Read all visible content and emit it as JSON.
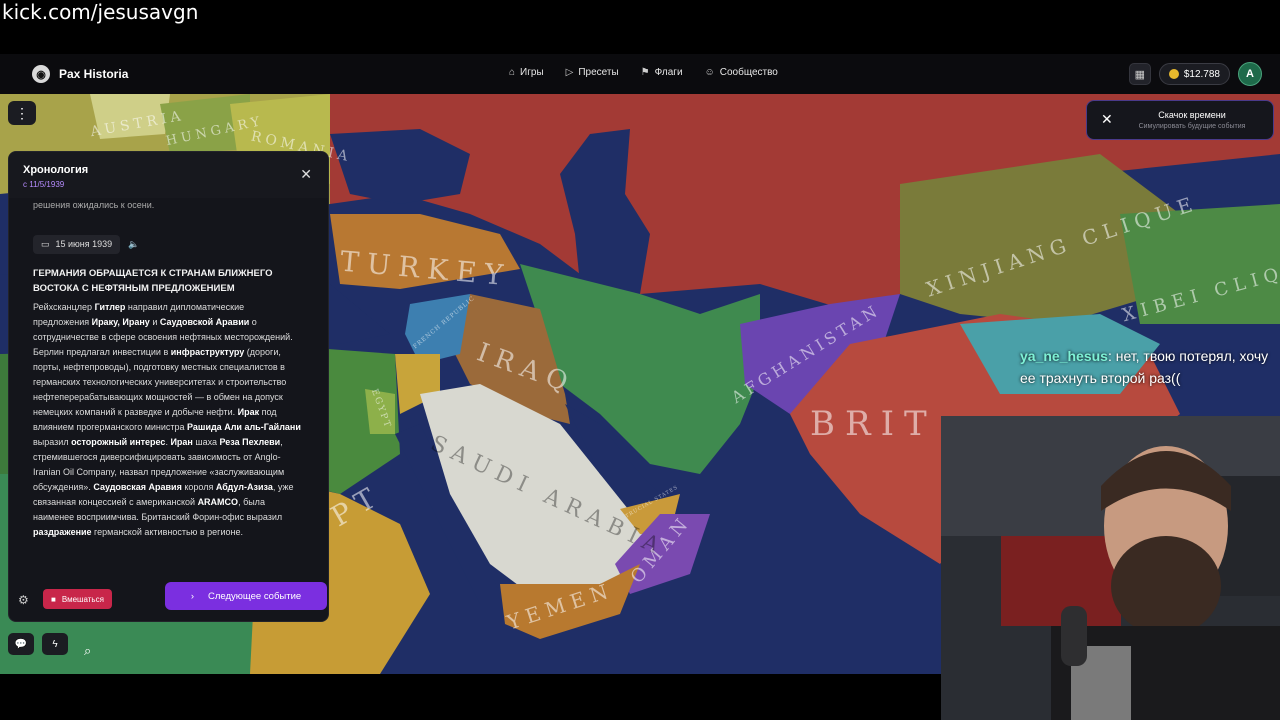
{
  "stream": {
    "url": "kick.com/jesusavgn"
  },
  "app": {
    "name": "Pax Historia",
    "nav": [
      {
        "icon": "gamepad-icon",
        "label": "Игры"
      },
      {
        "icon": "play-icon",
        "label": "Пресеты"
      },
      {
        "icon": "flag-icon",
        "label": "Флаги"
      },
      {
        "icon": "people-icon",
        "label": "Сообщество"
      }
    ],
    "balance": "$12.788",
    "avatar_initial": "A"
  },
  "time_jump": {
    "title": "Скачок времени",
    "subtitle": "Симулировать будущие события"
  },
  "timeline": {
    "title": "Хронология",
    "since": "с 11/5/1939",
    "prev_tail": "решения ожидались к осени.",
    "date": "15 июня 1939",
    "event_title": "ГЕРМАНИЯ ОБРАЩАЕТСЯ К СТРАНАМ БЛИЖНЕГО ВОСТОКА С НЕФТЯНЫМ ПРЕДЛОЖЕНИЕМ",
    "p1": "Рейхсканцлер ",
    "p1b": "Гитлер",
    "p2": " направил дипломатические предложения ",
    "p2b": "Ираку, Ирану",
    "p3": " и ",
    "p3b": "Саудовской Аравии",
    "p4": " о сотрудничестве в сфере освоения нефтяных месторождений. Берлин предлагал инвестиции в ",
    "p4b": "инфраструктуру",
    "p5": " (дороги, порты, нефтепроводы), подготовку местных специалистов в германских технологических университетах и строительство нефтеперерабатывающих мощностей — в обмен на допуск немецких компаний к разведке и добыче нефти. ",
    "p5b": "Ирак",
    "p6": " под влиянием прогерманского министра ",
    "p6b": "Рашида Али аль-Гайлани",
    "p7": " выразил ",
    "p7b": "осторожный интерес",
    "p8": ". ",
    "p8b": "Иран",
    "p9": " шаха ",
    "p9b": "Реза Пехлеви",
    "p10": ", стремившегося диверсифицировать зависимость от Anglo-Iranian Oil Company, назвал предложение «заслуживающим обсуждения». ",
    "p10b": "Саудовская Аравия",
    "p11": " короля ",
    "p11b": "Абдул-Азиза",
    "p12": ", уже связанная концессией с американской ",
    "p12b": "ARAMCO",
    "p13": ", была наименее восприимчива. Британский Форин-офис выразил ",
    "p13b": "раздражение",
    "p14": " германской активностью в регионе.",
    "intervene": "Вмешаться",
    "next": "Следующее событие"
  },
  "map_labels": {
    "austria": "AUSTRIA",
    "hungary": "HUNGARY",
    "romania": "ROMANIA",
    "turkey": "TURKEY",
    "iraq": "IRAQ",
    "saudi": "SAUDI ARABIA",
    "afghanistan": "AFGHANISTAN",
    "xinjiang": "XINJIANG CLIQUE",
    "xibei": "XIBEI CLIQ",
    "yemen": "YEMEN",
    "oman": "OMAN",
    "egypt": "EGYPT",
    "egypt_big": "PT",
    "brit": "BRIT",
    "french_rep": "FRENCH REPUBLIC",
    "trucial": "TRUCIAL STATES"
  },
  "chat": {
    "user": "ya_ne_hesus",
    "message": ": нет, твою потерял, хочу ее трахнуть второй раз(("
  },
  "colors": {
    "accent": "#7b2fe0",
    "intervene": "#c8264a",
    "ocean": "#1f2f66"
  }
}
